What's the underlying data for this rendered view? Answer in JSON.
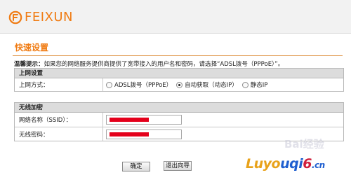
{
  "brand": {
    "logo_text": "FEIXUN",
    "accent": "#f07c14"
  },
  "page": {
    "title": "快速设置"
  },
  "tip": {
    "label": "温馨提示：",
    "text": "如果您的网络服务提供商提供了宽带接入的用户名和密码，请选择“ADSL拨号（PPPoE）”。"
  },
  "internet": {
    "section_title": "上网设置",
    "mode_label": "上网方式：",
    "options": [
      {
        "label": "ADSL拨号（PPPoE）",
        "selected": false
      },
      {
        "label": "自动获取（动态IP）",
        "selected": true
      },
      {
        "label": "静态IP",
        "selected": false
      }
    ]
  },
  "wireless": {
    "section_title": "无线加密",
    "ssid_label": "网络名称（SSID）：",
    "password_label": "无线密码："
  },
  "buttons": {
    "confirm": "确定",
    "exit": "退出向导"
  },
  "watermark": {
    "part1": "Luyo",
    "part2": "uqi",
    "part3": "6",
    "part4": ".cn",
    "baidu": "Bai经验"
  }
}
